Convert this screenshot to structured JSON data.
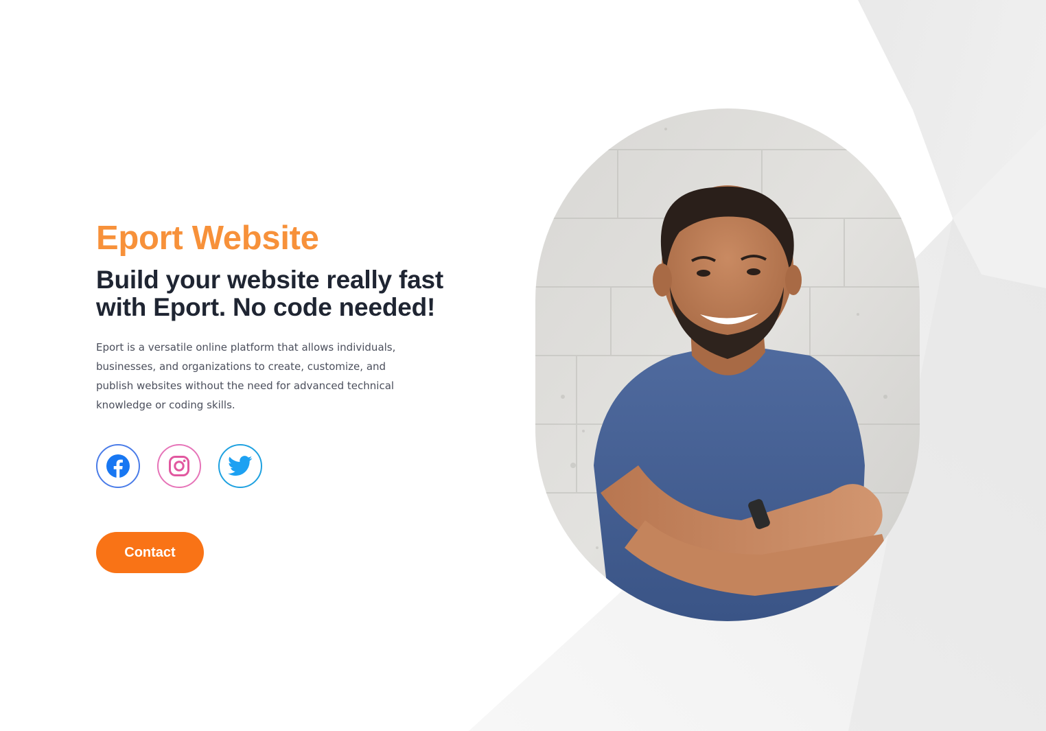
{
  "brand": {
    "title": "Eport Website",
    "accent_color": "#f7913a"
  },
  "hero": {
    "headline": "Build your website really fast with Eport. No code needed!",
    "description": "Eport is a versatile online platform that allows individuals, businesses, and organizations to create, customize, and publish websites without the need for advanced technical knowledge or coding skills."
  },
  "socials": [
    {
      "name": "facebook",
      "icon": "facebook-icon",
      "color": "#4a7ce8"
    },
    {
      "name": "instagram",
      "icon": "instagram-icon",
      "color": "#e674b8"
    },
    {
      "name": "twitter",
      "icon": "twitter-icon",
      "color": "#1ea1e0"
    }
  ],
  "contact_button": {
    "label": "Contact",
    "color": "#f97316"
  },
  "portrait": {
    "subject": "smiling-man-arms-crossed"
  }
}
